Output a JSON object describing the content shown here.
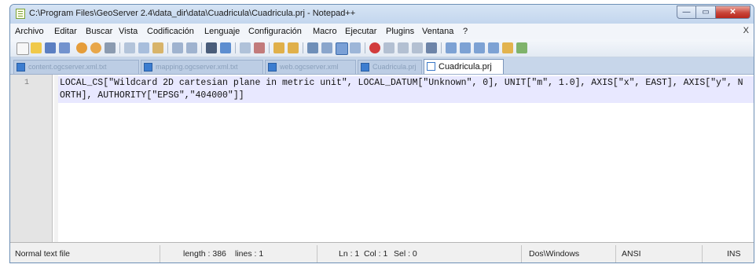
{
  "window": {
    "title": "C:\\Program Files\\GeoServer 2.4\\data_dir\\data\\Cuadricula\\Cuadricula.prj - Notepad++",
    "minimize_glyph": "—",
    "maximize_glyph": "▭",
    "close_glyph": "✕"
  },
  "menu": {
    "items": [
      "Archivo",
      "Editar",
      "Buscar",
      "Vista",
      "Codificación",
      "Lenguaje",
      "Configuración",
      "Macro",
      "Ejecutar",
      "Plugins",
      "Ventana",
      "?"
    ],
    "close_glyph": "X"
  },
  "toolbar": {
    "icons": [
      "new-file-icon",
      "open-file-icon",
      "save-icon",
      "save-all-icon",
      "close-icon",
      "close-all-icon",
      "print-icon",
      "cut-icon",
      "copy-icon",
      "paste-icon",
      "undo-icon",
      "redo-icon",
      "find-icon",
      "replace-icon",
      "zoom-in-icon",
      "zoom-out-icon",
      "sync-vertical-icon",
      "sync-horizontal-icon",
      "word-wrap-icon",
      "show-all-chars-icon",
      "indent-guide-icon",
      "user-language-icon",
      "record-macro-icon",
      "stop-record-icon",
      "play-macro-icon",
      "play-multiple-icon",
      "save-macro-icon",
      "bookmark-icon",
      "up-icon",
      "down-icon",
      "collapse-icon",
      "spell-check-icon",
      "plugin-icon"
    ]
  },
  "tabs": [
    {
      "label": "content.ogcserver.xml.txt",
      "active": false
    },
    {
      "label": "mapping.ogcserver.xml.txt",
      "active": false
    },
    {
      "label": "web.ogcserver.xml",
      "active": false
    },
    {
      "label": "Cuadricula.prj",
      "active": false
    },
    {
      "label": "Cuadricula.prj",
      "active": true
    }
  ],
  "editor": {
    "line_number": "1",
    "content": "LOCAL_CS[\"Wildcard 2D cartesian plane in metric unit\", LOCAL_DATUM[\"Unknown\", 0], UNIT[\"m\", 1.0], AXIS[\"x\", EAST], AXIS[\"y\", NORTH], AUTHORITY[\"EPSG\",\"404000\"]]"
  },
  "status": {
    "file_type": "Normal text file",
    "length": "length : 386",
    "lines": "lines : 1",
    "ln": "Ln : 1",
    "col": "Col : 1",
    "sel": "Sel : 0",
    "eol": "Dos\\Windows",
    "encoding": "ANSI",
    "mode": "INS"
  },
  "colors": {
    "title_bar": "#c3d6ee",
    "close_button": "#c9453a",
    "current_line": "#e8e8ff",
    "gutter": "#e4e4e4"
  }
}
